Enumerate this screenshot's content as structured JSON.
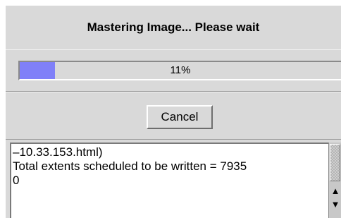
{
  "dialog": {
    "title": "Mastering Image... Please wait"
  },
  "progress": {
    "value": 0.11,
    "label": "11%",
    "fill_color": "#8080f8"
  },
  "actions": {
    "cancel_label": "Cancel"
  },
  "log": {
    "lines": [
      "–10.33.153.html)",
      "Total extents scheduled to be written = 7935",
      "0"
    ]
  },
  "scrollbar": {
    "up_icon": "▲",
    "down_icon": "▼"
  }
}
